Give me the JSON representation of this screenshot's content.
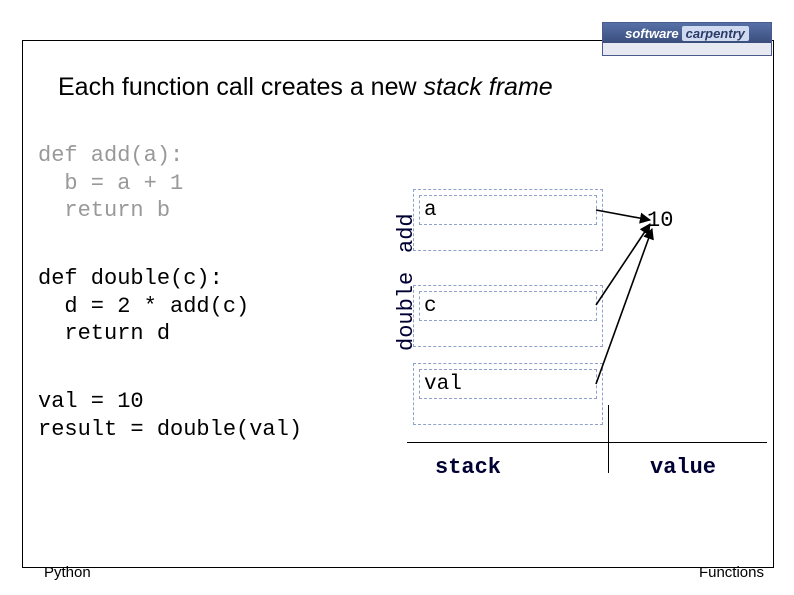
{
  "logo": {
    "left": "software",
    "right": "carpentry",
    "tagline": ""
  },
  "title": {
    "prefix": "Each function call creates a new ",
    "emph": "stack frame"
  },
  "code": {
    "add": "def add(a):\n  b = a + 1\n  return b",
    "double": "def double(c):\n  d = 2 * add(c)\n  return d",
    "main": "val = 10\nresult = double(val)"
  },
  "stack_labels": {
    "add": "add",
    "double": "double"
  },
  "vars": {
    "a": "a",
    "c": "c",
    "val": "val"
  },
  "value": "10",
  "axis": {
    "stack": "stack",
    "value": "value"
  },
  "footer": {
    "left": "Python",
    "right": "Functions"
  }
}
